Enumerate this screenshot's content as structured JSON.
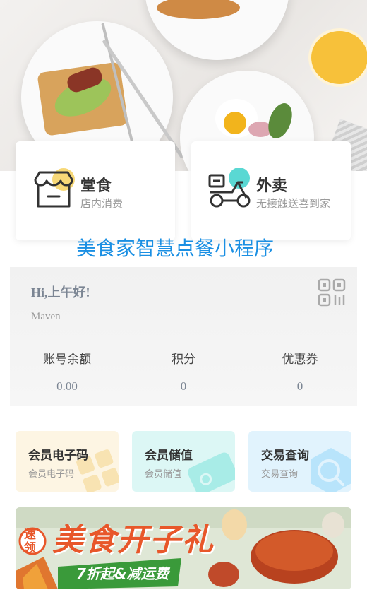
{
  "services": {
    "dine_in": {
      "title": "堂食",
      "subtitle": "店内消费",
      "icon": "storefront-icon"
    },
    "takeout": {
      "title": "外卖",
      "subtitle": "无接触送喜到家",
      "icon": "delivery-scooter-icon"
    }
  },
  "app_title": "美食家智慧点餐小程序",
  "member": {
    "greeting": "Hi,上午好!",
    "username": "Maven",
    "qr_icon": "qr-code-icon",
    "stats": [
      {
        "label": "账号余额",
        "value": "0.00"
      },
      {
        "label": "积分",
        "value": "0"
      },
      {
        "label": "优惠券",
        "value": "0"
      }
    ]
  },
  "quick_actions": [
    {
      "title": "会员电子码",
      "subtitle": "会员电子码",
      "color": "#fdf5e3",
      "icon": "grid-code-icon"
    },
    {
      "title": "会员储值",
      "subtitle": "会员储值",
      "color": "#dcf7f5",
      "icon": "card-icon"
    },
    {
      "title": "交易查询",
      "subtitle": "交易查询",
      "color": "#e1f3fd",
      "icon": "magnifier-icon"
    }
  ],
  "banner": {
    "badge": "速领",
    "headline": "美食开子礼",
    "ribbon": "7折起&减运费"
  },
  "colors": {
    "accent": "#1a8fe3",
    "dine_in_blob": "#f7d877",
    "takeout_blob": "#5ad8d3",
    "banner_headline": "#e8572a",
    "banner_ribbon": "#3a9a3a"
  }
}
